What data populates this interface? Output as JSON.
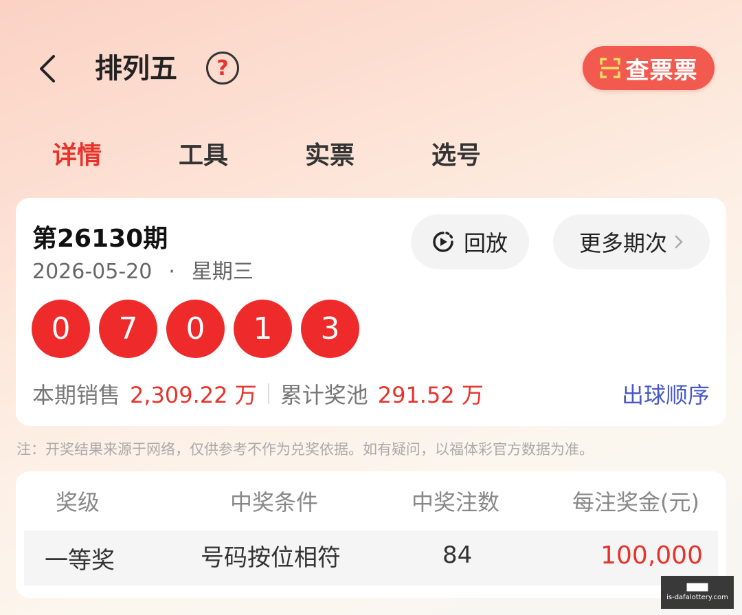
{
  "header": {
    "title": "排列五",
    "help": "?",
    "check_ticket": "查票票"
  },
  "tabs": [
    "详情",
    "工具",
    "实票",
    "选号"
  ],
  "draw": {
    "issue": "第26130期",
    "date": "2026-05-20",
    "dot": "·",
    "weekday": "星期三",
    "replay_label": "回放",
    "more_label": "更多期次",
    "balls": [
      "0",
      "7",
      "0",
      "1",
      "3"
    ],
    "sales_label": "本期销售",
    "sales_value": "2,309.22 万",
    "pool_label": "累计奖池",
    "pool_value": "291.52 万",
    "order_link": "出球顺序"
  },
  "note": "注：开奖结果来源于网络，仅供参考不作为兑奖依据。如有疑问，以福体彩官方数据为准。",
  "prize_table": {
    "headers": [
      "奖级",
      "中奖条件",
      "中奖注数",
      "每注奖金(元)"
    ],
    "rows": [
      {
        "level": "一等奖",
        "condition": "号码按位相符",
        "count": "84",
        "amount": "100,000"
      }
    ]
  },
  "watermark": {
    "line1": "████",
    "line2": "is-dafalottery.com"
  },
  "colors": {
    "accent": "#e8322c",
    "ball": "#ee2a2a",
    "link": "#4857c9",
    "check_button": "#f2594f"
  }
}
